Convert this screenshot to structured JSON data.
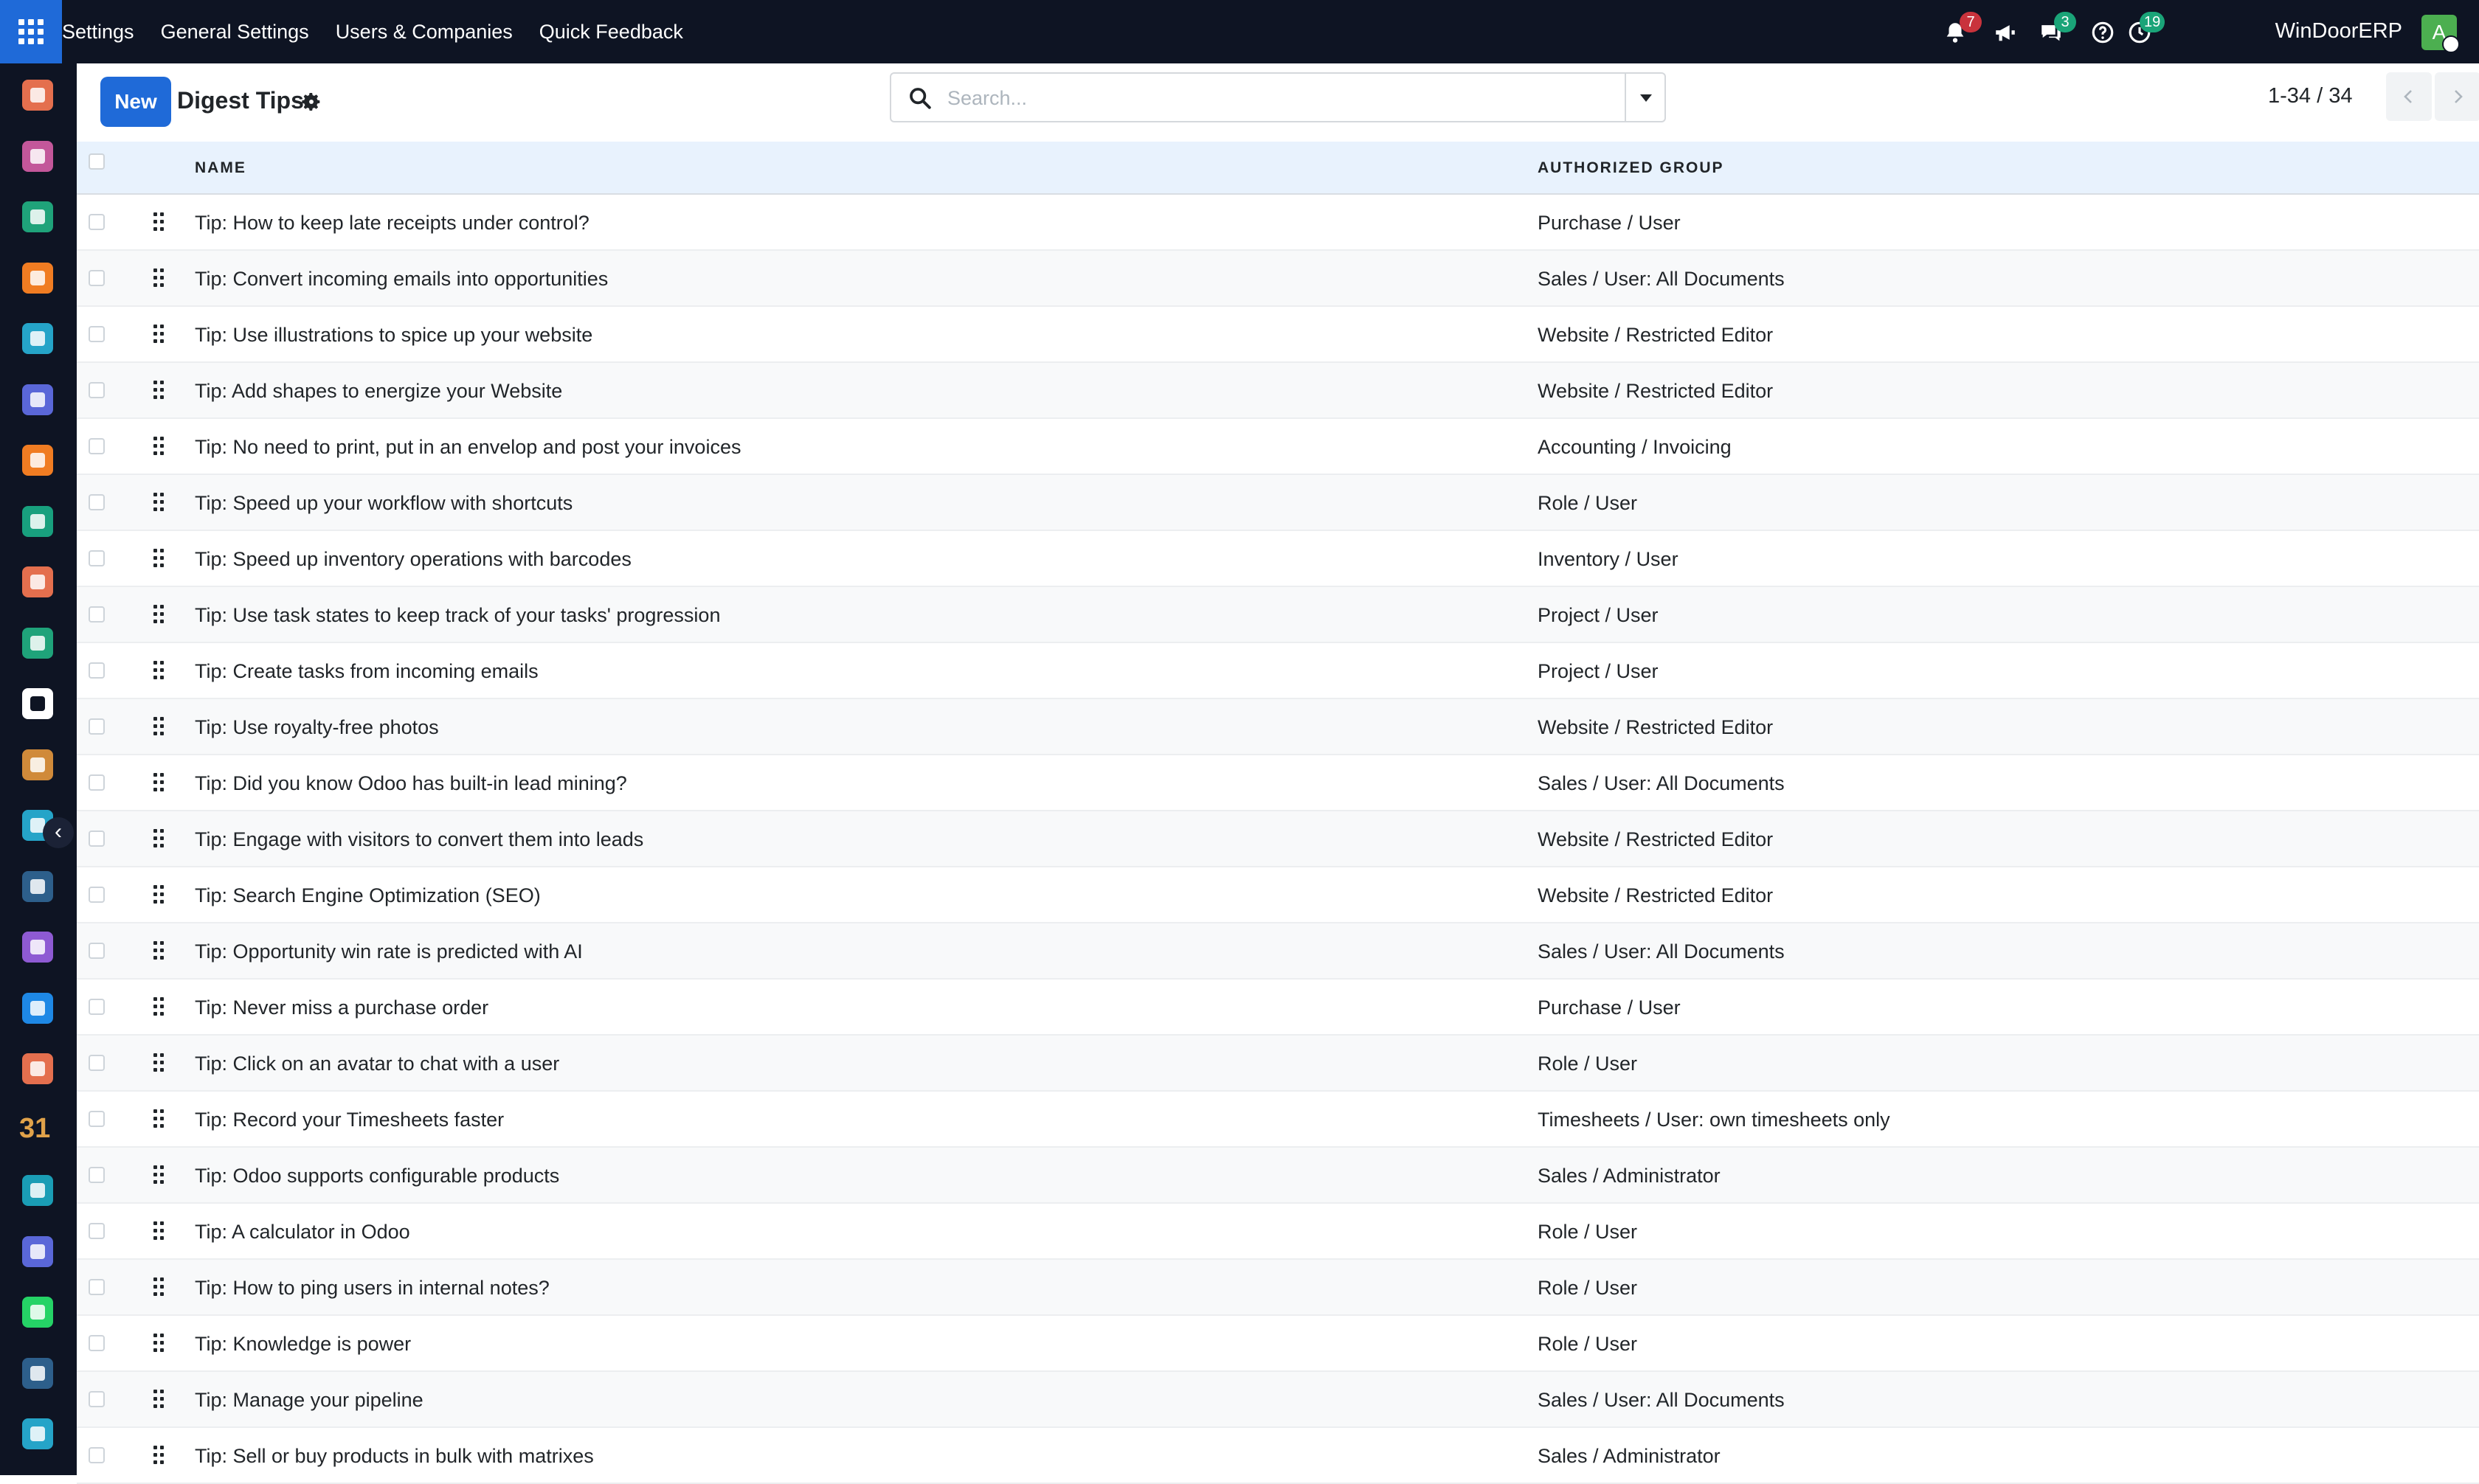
{
  "topbar": {
    "menu": [
      "Settings",
      "General Settings",
      "Users & Companies",
      "Quick Feedback"
    ],
    "notifications_count": "7",
    "messages_count": "3",
    "activities_count": "19",
    "company_name": "WinDoorERP",
    "avatar_letter": "A"
  },
  "control": {
    "new_label": "New",
    "title": "Digest Tips",
    "search_placeholder": "Search...",
    "pager": "1-34 / 34"
  },
  "columns": {
    "name": "NAME",
    "group": "AUTHORIZED GROUP"
  },
  "rows": [
    {
      "name": "Tip: How to keep late receipts under control?",
      "group": "Purchase / User"
    },
    {
      "name": "Tip: Convert incoming emails into opportunities",
      "group": "Sales / User: All Documents"
    },
    {
      "name": "Tip: Use illustrations to spice up your website",
      "group": "Website / Restricted Editor"
    },
    {
      "name": "Tip: Add shapes to energize your Website",
      "group": "Website / Restricted Editor"
    },
    {
      "name": "Tip: No need to print, put in an envelop and post your invoices",
      "group": "Accounting / Invoicing"
    },
    {
      "name": "Tip: Speed up your workflow with shortcuts",
      "group": "Role / User"
    },
    {
      "name": "Tip: Speed up inventory operations with barcodes",
      "group": "Inventory / User"
    },
    {
      "name": "Tip: Use task states to keep track of your tasks' progression",
      "group": "Project / User"
    },
    {
      "name": "Tip: Create tasks from incoming emails",
      "group": "Project / User"
    },
    {
      "name": "Tip: Use royalty-free photos",
      "group": "Website / Restricted Editor"
    },
    {
      "name": "Tip: Did you know Odoo has built-in lead mining?",
      "group": "Sales / User: All Documents"
    },
    {
      "name": "Tip: Engage with visitors to convert them into leads",
      "group": "Website / Restricted Editor"
    },
    {
      "name": "Tip: Search Engine Optimization (SEO)",
      "group": "Website / Restricted Editor"
    },
    {
      "name": "Tip: Opportunity win rate is predicted with AI",
      "group": "Sales / User: All Documents"
    },
    {
      "name": "Tip: Never miss a purchase order",
      "group": "Purchase / User"
    },
    {
      "name": "Tip: Click on an avatar to chat with a user",
      "group": "Role / User"
    },
    {
      "name": "Tip: Record your Timesheets faster",
      "group": "Timesheets / User: own timesheets only"
    },
    {
      "name": "Tip: Odoo supports configurable products",
      "group": "Sales / Administrator"
    },
    {
      "name": "Tip: A calculator in Odoo",
      "group": "Role / User"
    },
    {
      "name": "Tip: How to ping users in internal notes?",
      "group": "Role / User"
    },
    {
      "name": "Tip: Knowledge is power",
      "group": "Role / User"
    },
    {
      "name": "Tip: Manage your pipeline",
      "group": "Sales / User: All Documents"
    },
    {
      "name": "Tip: Sell or buy products in bulk with matrixes",
      "group": "Sales / Administrator"
    }
  ],
  "sidebar": {
    "calendar_text": "31",
    "apps": [
      {
        "icon": "purchase-app-icon",
        "color": "#e46f4e"
      },
      {
        "icon": "photos-app-icon",
        "color": "#c3579a"
      },
      {
        "icon": "contacts-app-icon",
        "color": "#1fa37a"
      },
      {
        "icon": "discuss-app-icon",
        "color": "#f07c22"
      },
      {
        "icon": "website-app-icon",
        "color": "#25a4c8"
      },
      {
        "icon": "email-marketing-app-icon",
        "color": "#5a67d8"
      },
      {
        "icon": "livechat-app-icon",
        "color": "#f07c22"
      },
      {
        "icon": "crm-app-icon",
        "color": "#18a07e"
      },
      {
        "icon": "sales-app-icon",
        "color": "#e46f4e"
      },
      {
        "icon": "employees-app-icon",
        "color": "#1fa37a"
      },
      {
        "icon": "inventory-app-icon",
        "color": "#ffffff"
      },
      {
        "icon": "marketing-app-icon",
        "color": "#d08a3a"
      },
      {
        "icon": "project-app-icon",
        "color": "#25a4c8"
      },
      {
        "icon": "elearning-app-icon",
        "color": "#2d5f8b"
      },
      {
        "icon": "products-app-icon",
        "color": "#8e5ad3"
      },
      {
        "icon": "invoicing-app-icon",
        "color": "#1e88e5"
      },
      {
        "icon": "members-app-icon",
        "color": "#e46f4e"
      },
      {
        "icon": "calendar-app-icon",
        "color": "#e0a24a"
      },
      {
        "icon": "sign-app-icon",
        "color": "#1a9db5"
      },
      {
        "icon": "dashboards-app-icon",
        "color": "#5a67d8"
      },
      {
        "icon": "whatsapp-app-icon",
        "color": "#25d366"
      },
      {
        "icon": "timesheets-app-icon",
        "color": "#2d5f8b"
      },
      {
        "icon": "settings-app-icon",
        "color": "#25a4c8"
      }
    ]
  },
  "colors": {
    "brand_blue": "#1f6ad8",
    "navbar": "#0e1423",
    "header_bg": "#e8f2fd",
    "badge_red": "#c9333c",
    "badge_green": "#1aa478"
  }
}
